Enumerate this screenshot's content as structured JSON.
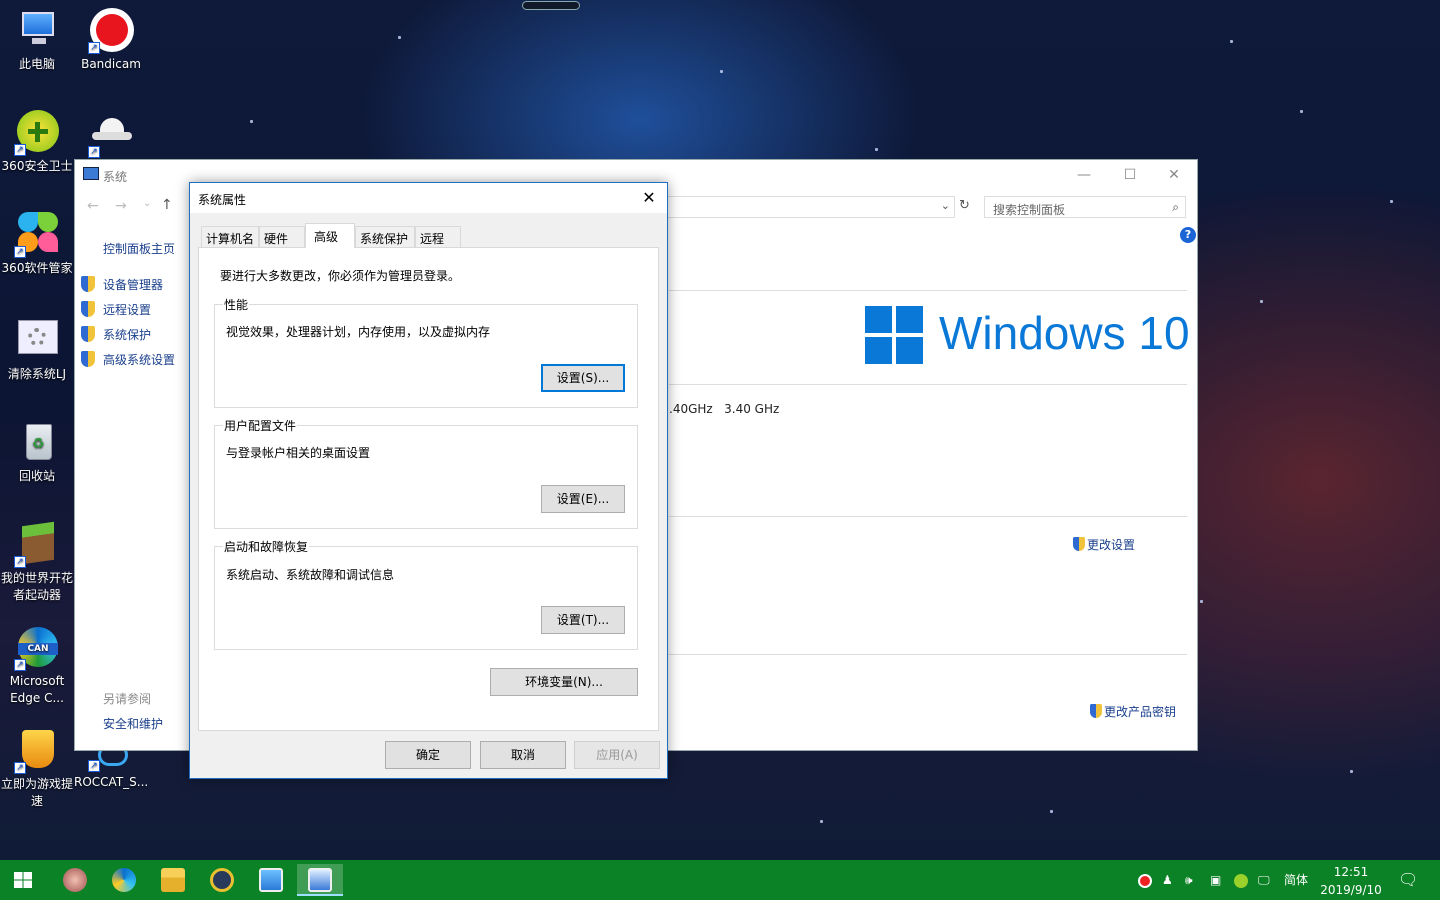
{
  "desktop": {
    "icons": [
      {
        "label": "此电脑",
        "icon": "computer-icon"
      },
      {
        "label": "Bandicam",
        "icon": "record-icon"
      },
      {
        "label": "360安全卫士",
        "icon": "shield-plus-icon"
      },
      {
        "label": "",
        "icon": "cloud-hat-icon"
      },
      {
        "label": "360软件管家",
        "icon": "pinwheel-icon"
      },
      {
        "label": "清除系统LJ",
        "icon": "gear-icon"
      },
      {
        "label": "回收站",
        "icon": "recycle-bin-icon"
      },
      {
        "label": "我的世界开花者起动器",
        "icon": "minecraft-icon"
      },
      {
        "label": "Microsoft Edge C...",
        "icon": "edge-icon"
      },
      {
        "label": "立即为游戏提速",
        "icon": "game-boost-icon"
      },
      {
        "label": "ROCCAT_S...",
        "icon": "roccat-icon"
      }
    ]
  },
  "system_window": {
    "title": "系统",
    "search_placeholder": "搜索控制面板",
    "left_nav": {
      "home": "控制面板主页",
      "items": [
        "设备管理器",
        "远程设置",
        "系统保护",
        "高级系统设置"
      ],
      "see_also_label": "另请参阅",
      "see_also_items": [
        "安全和维护"
      ]
    },
    "brand_text": "Windows 10",
    "processor_fragment": ".40GHz   3.40 GHz",
    "change_settings": "更改设置",
    "change_product_key": "更改产品密钥"
  },
  "dialog": {
    "title": "系统属性",
    "tabs": [
      "计算机名",
      "硬件",
      "高级",
      "系统保护",
      "远程"
    ],
    "active_tab": "高级",
    "admin_note": "要进行大多数更改，你必须作为管理员登录。",
    "groups": [
      {
        "title": "性能",
        "desc": "视觉效果，处理器计划，内存使用，以及虚拟内存",
        "button": "设置(S)..."
      },
      {
        "title": "用户配置文件",
        "desc": "与登录帐户相关的桌面设置",
        "button": "设置(E)..."
      },
      {
        "title": "启动和故障恢复",
        "desc": "系统启动、系统故障和调试信息",
        "button": "设置(T)..."
      }
    ],
    "env_button": "环境变量(N)...",
    "ok": "确定",
    "cancel": "取消",
    "apply": "应用(A)"
  },
  "taskbar": {
    "apps": [
      "start-icon",
      "avatar-icon",
      "edge-can-icon",
      "file-explorer-icon",
      "security-icon",
      "control-panel-icon",
      "system-props-icon"
    ],
    "ime": "简体",
    "time": "12:51",
    "date": "2019/9/10"
  },
  "colors": {
    "accent": "#0078d7",
    "taskbar": "#0b8226",
    "brand_blue": "#0a78d7"
  }
}
